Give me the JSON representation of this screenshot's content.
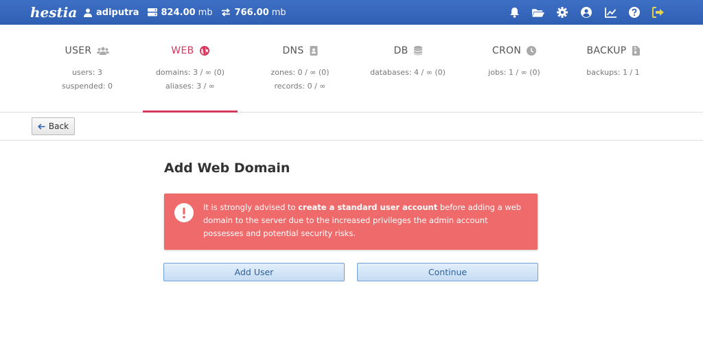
{
  "topbar": {
    "logo": "hestia",
    "username": "adiputra",
    "disk_value": "824.00",
    "disk_unit": "mb",
    "bandwidth_value": "766.00",
    "bandwidth_unit": "mb",
    "icons": [
      "bell-icon",
      "folder-open-icon",
      "gear-icon",
      "user-circle-icon",
      "chart-line-icon",
      "help-icon",
      "logout-icon"
    ]
  },
  "tabs": [
    {
      "label": "USER",
      "icon": "users-icon",
      "stats": [
        "users: 3",
        "suspended: 0"
      ]
    },
    {
      "label": "WEB",
      "icon": "globe-icon",
      "stats": [
        "domains: 3 / ∞ (0)",
        "aliases: 3 / ∞"
      ],
      "active": true
    },
    {
      "label": "DNS",
      "icon": "address-book-icon",
      "stats": [
        "zones: 0 / ∞ (0)",
        "records: 0 / ∞"
      ]
    },
    {
      "label": "DB",
      "icon": "database-icon",
      "stats": [
        "databases: 4 / ∞ (0)"
      ]
    },
    {
      "label": "CRON",
      "icon": "clock-icon",
      "stats": [
        "jobs: 1 / ∞ (0)"
      ]
    },
    {
      "label": "BACKUP",
      "icon": "file-archive-icon",
      "stats": [
        "backups: 1 / 1"
      ]
    }
  ],
  "toolbar": {
    "back_label": "Back"
  },
  "main": {
    "title": "Add Web Domain",
    "alert": {
      "before": "It is strongly advised to ",
      "strong": "create a standard user account",
      "after": " before adding a web domain to the server due to the increased privileges the admin account possesses and potential security risks."
    },
    "add_user_label": "Add User",
    "continue_label": "Continue"
  },
  "colors": {
    "topbar": "#2f5fb3",
    "active_tab": "#d3385d",
    "alert_bg": "#ef6a6b",
    "logout_icon": "#e6d34a"
  }
}
